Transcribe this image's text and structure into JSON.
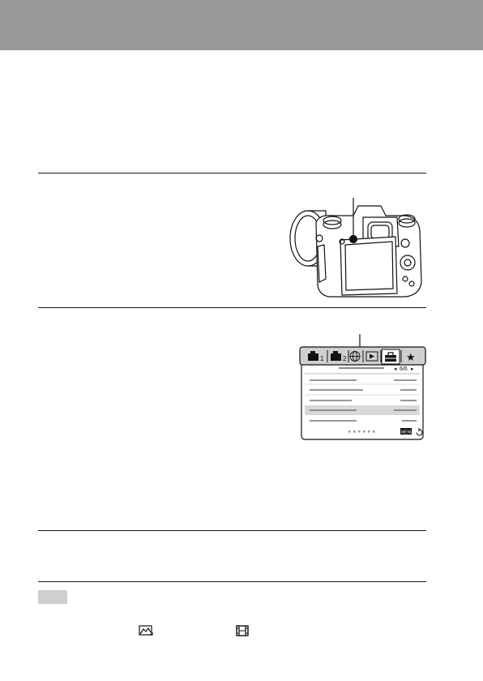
{
  "page": {
    "header_color": "#9a9a9a"
  },
  "menu_screen": {
    "page_indicator": "6/6",
    "tabs": [
      "camera-settings-1-icon",
      "camera-settings-2-icon",
      "network-icon",
      "playback-icon",
      "setup-icon",
      "my-menu-icon"
    ],
    "tab_numbers": [
      "1",
      "2"
    ],
    "selected_tab": "setup-icon",
    "footer_button": "MENU",
    "page_dots": 6
  },
  "note_icons": [
    "still-image-mode-icon",
    "movie-mode-icon"
  ]
}
